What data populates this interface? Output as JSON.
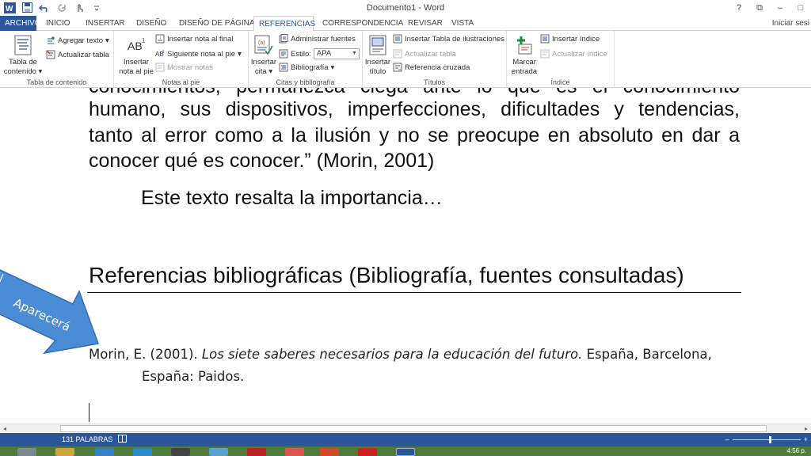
{
  "window": {
    "title": "Documento1 - Word",
    "controls": [
      "?",
      "⧉",
      "–",
      "□"
    ]
  },
  "tabs": {
    "file": "ARCHIVO",
    "items": [
      "INICIO",
      "INSERTAR",
      "DISEÑO",
      "DISEÑO DE PÁGINA",
      "REFERENCIAS",
      "CORRESPONDENCIA",
      "REVISAR",
      "VISTA"
    ],
    "active": "REFERENCIAS",
    "signin": "Iniciar sesi"
  },
  "ribbon": {
    "toc": {
      "big_label_1": "Tabla de",
      "big_label_2": "contenido",
      "add_text": "Agregar texto",
      "update_table": "Actualizar tabla",
      "group": "Tabla de contenido"
    },
    "footnotes": {
      "big_label_1": "Insertar",
      "big_label_2": "nota al pie",
      "insert_endnote": "Insertar nota al final",
      "next_footnote": "Siguiente nota al pie",
      "show_notes": "Mostrar notas",
      "group": "Notas al pie"
    },
    "citations": {
      "big_label_1": "Insertar",
      "big_label_2": "cita",
      "manage_sources": "Administrar fuentes",
      "style_label": "Estilo:",
      "style_value": "APA",
      "bibliography": "Bibliografía",
      "group": "Citas y bibliografía"
    },
    "captions": {
      "big_label_1": "Insertar",
      "big_label_2": "título",
      "insert_table_figures": "Insertar Tabla de ilustraciones",
      "update_table": "Actualizar tabla",
      "cross_reference": "Referencia cruzada",
      "group": "Títulos"
    },
    "index": {
      "big_label_1": "Marcar",
      "big_label_2": "entrada",
      "insert_index": "Insertar índice",
      "update_index": "Actualizar índice",
      "group": "Índice"
    }
  },
  "document": {
    "cut_line": "conocimientos, permanezca ciega ante lo que es el conocimiento",
    "quote_lines": [
      "humano, sus dispositivos, imperfecciones, dificultades y tendencias,",
      "tanto al error como a la ilusión y no se preocupe en absoluto en dar a"
    ],
    "quote_last": "conocer qué es conocer.” (Morin, 2001)",
    "body_text": "Este texto resalta la importancia…",
    "heading": "Referencias bibliográficas (Bibliografía, fuentes consultadas)",
    "arrow_label": "Aparecerá",
    "reference": {
      "prefix": "Morin, E. (2001). ",
      "title": "Los siete saberes necesarios para la educación del futuro.",
      "suffix": " España, Barcelona,",
      "line2": "España: Paidos."
    }
  },
  "status": {
    "words": "131 PALABRAS",
    "zoom_out": "–",
    "zoom_in": "+"
  },
  "taskbar": {
    "time": "4:56 p."
  },
  "colors": {
    "word_blue": "#2b579a",
    "arrow_blue": "#4a8cd6",
    "taskbar_green": "#4f7c3a"
  }
}
